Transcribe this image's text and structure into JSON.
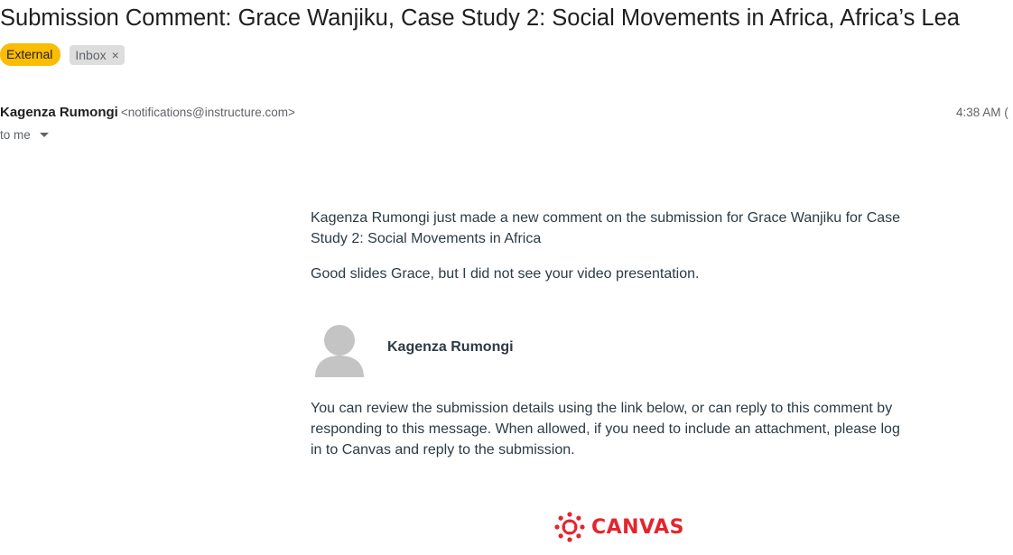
{
  "email": {
    "subject": "Submission Comment: Grace Wanjiku, Case Study 2: Social Movements in Africa, Africa’s Lea",
    "labels": {
      "external": "External",
      "inbox": "Inbox",
      "remove_symbol": "×"
    },
    "sender": {
      "name": "Kagenza Rumongi",
      "email": "<notifications@instructure.com>"
    },
    "time": "4:38 AM (",
    "to": "to me"
  },
  "message": {
    "intro": "Kagenza Rumongi just made a new comment on the submission for Grace Wanjiku for Case Study 2: Social Movements in Africa",
    "comment": "Good slides Grace, but I did not see your video presentation.",
    "commenter_name": "Kagenza Rumongi",
    "instructions": "You can review the submission details using the link below, or can reply to this comment by responding to this message. When allowed, if you need to include an attachment, please log in to Canvas and reply to the submission.",
    "logo_text": "CANVAS"
  },
  "colors": {
    "external_label_bg": "#fbbc04",
    "inbox_label_bg": "#dddddd",
    "canvas_red": "#e4252d",
    "body_text": "#2d3b45"
  },
  "icons": {
    "label_close": "close-icon",
    "recipients_toggle": "chevron-down-icon",
    "avatar": "person-avatar-icon",
    "logo": "canvas-logo-icon"
  }
}
